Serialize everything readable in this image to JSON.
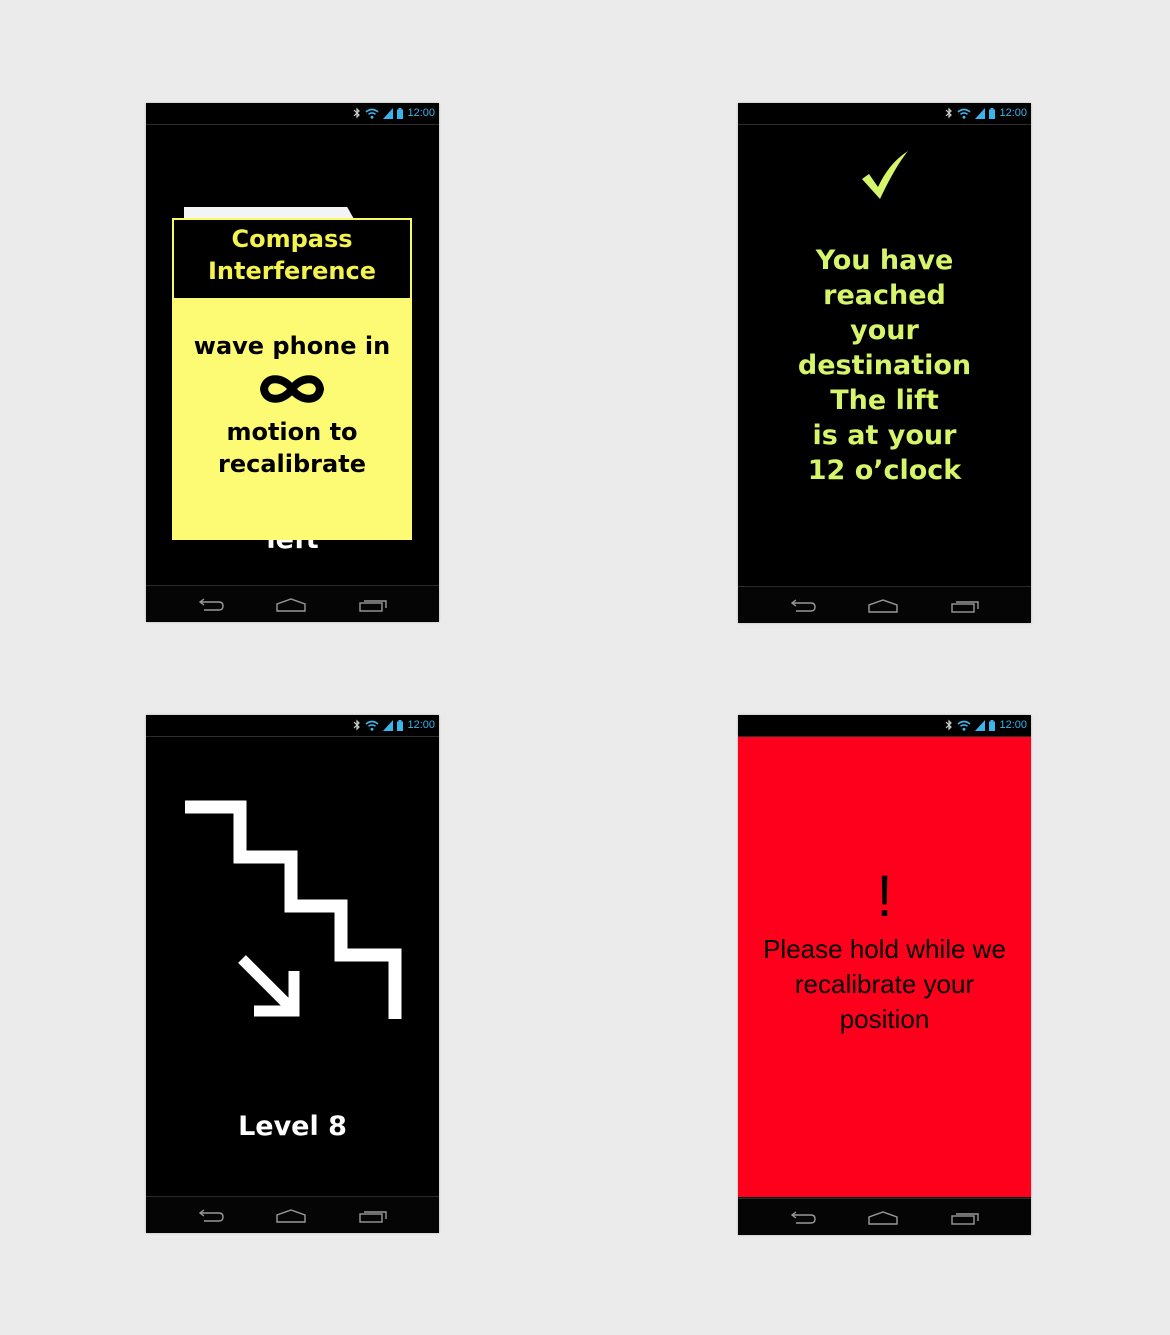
{
  "status_time": "12:00",
  "colors": {
    "background": "#ebebeb",
    "status_icon_blue": "#3ab4ec",
    "yellow_card": "#fdfb74",
    "yellow_title": "#f4f24c",
    "green_text": "#d6f56a",
    "alert_red": "#ff001c"
  },
  "icons": {
    "status": [
      "bluetooth-icon",
      "wifi-icon",
      "signal-icon",
      "battery-icon"
    ],
    "nav": [
      "back-icon",
      "home-icon",
      "recent-apps-icon"
    ],
    "screen_2": "checkmark-icon",
    "screen_1": "infinity-icon",
    "screen_3": [
      "stairs-down-icon",
      "arrow-down-right-icon"
    ]
  },
  "screens": {
    "compass": {
      "title_line1": "Compass",
      "title_line2": "Interference",
      "instruction_line1": "wave phone in",
      "instruction_line2": "motion to",
      "instruction_line3": "recalibrate",
      "behind_text": "left"
    },
    "destination": {
      "lines": [
        "You have",
        "reached",
        "your",
        "destination",
        "The lift",
        "is at your",
        "12 o’clock"
      ]
    },
    "stairs": {
      "level": "Level 8"
    },
    "recalibrate": {
      "mark": "!",
      "lines": [
        "Please hold while we",
        "recalibrate your",
        "position"
      ]
    }
  }
}
